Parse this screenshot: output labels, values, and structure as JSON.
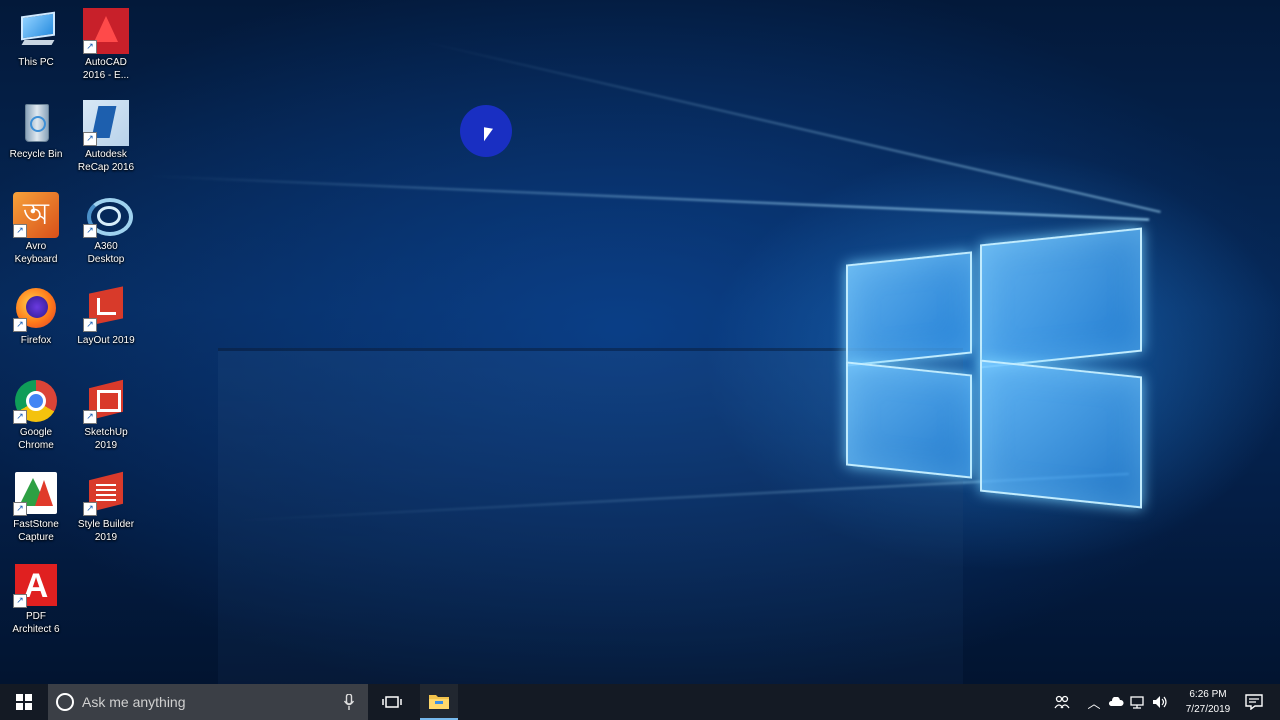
{
  "desktop": {
    "icons": [
      {
        "label": "This PC",
        "icon": "this-pc-icon",
        "color": "#4aa3e8"
      },
      {
        "label": "AutoCAD\n2016 - E...",
        "icon": "autocad-icon",
        "color": "#c8202a"
      },
      {
        "label": "Recycle Bin",
        "icon": "recycle-bin-icon",
        "color": "#9db4c8"
      },
      {
        "label": "Autodesk\nReCap 2016",
        "icon": "recap-icon",
        "color": "#2a6fb8"
      },
      {
        "label": "Avro\nKeyboard",
        "icon": "avro-keyboard-icon",
        "color": "#e06010",
        "glyph": "অ"
      },
      {
        "label": "A360\nDesktop",
        "icon": "a360-icon",
        "color": "#8ec6e8"
      },
      {
        "label": "Firefox",
        "icon": "firefox-icon",
        "color": "#ff7a1a"
      },
      {
        "label": "LayOut 2019",
        "icon": "layout-icon",
        "color": "#d83a2a"
      },
      {
        "label": "Google\nChrome",
        "icon": "chrome-icon",
        "color": "#db4437"
      },
      {
        "label": "SketchUp\n2019",
        "icon": "sketchup-icon",
        "color": "#d93a2b"
      },
      {
        "label": "FastStone\nCapture",
        "icon": "faststone-capture-icon",
        "color": "#2ea043"
      },
      {
        "label": "Style Builder\n2019",
        "icon": "style-builder-icon",
        "color": "#d93a2b"
      },
      {
        "label": "PDF\nArchitect 6",
        "icon": "pdf-architect-icon",
        "color": "#e02020",
        "glyph": "A"
      }
    ]
  },
  "taskbar": {
    "search_placeholder": "Ask me anything",
    "clock_time": "6:26 PM",
    "clock_date": "7/27/2019"
  }
}
